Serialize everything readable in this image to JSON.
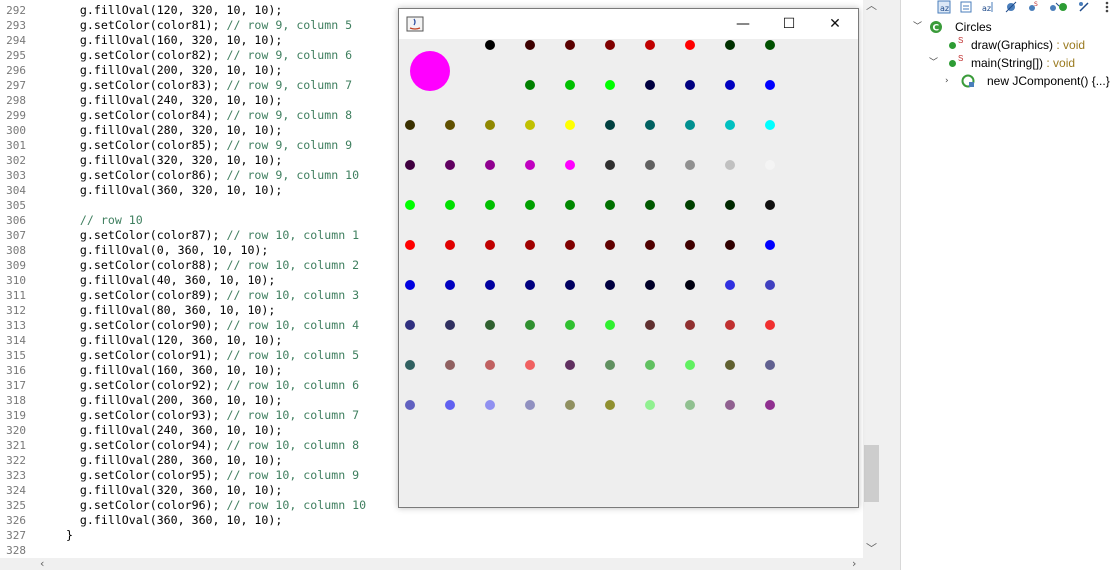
{
  "editor": {
    "lines": [
      {
        "num": "292",
        "code": "    g.fillOval(120, 320, 10, 10);",
        "comment": ""
      },
      {
        "num": "293",
        "code": "    g.setColor(color81); ",
        "comment": "// row 9, column 5"
      },
      {
        "num": "294",
        "code": "    g.fillOval(160, 320, 10, 10);",
        "comment": ""
      },
      {
        "num": "295",
        "code": "    g.setColor(color82); ",
        "comment": "// row 9, column 6"
      },
      {
        "num": "296",
        "code": "    g.fillOval(200, 320, 10, 10);",
        "comment": ""
      },
      {
        "num": "297",
        "code": "    g.setColor(color83); ",
        "comment": "// row 9, column 7"
      },
      {
        "num": "298",
        "code": "    g.fillOval(240, 320, 10, 10);",
        "comment": ""
      },
      {
        "num": "299",
        "code": "    g.setColor(color84); ",
        "comment": "// row 9, column 8"
      },
      {
        "num": "300",
        "code": "    g.fillOval(280, 320, 10, 10);",
        "comment": ""
      },
      {
        "num": "301",
        "code": "    g.setColor(color85); ",
        "comment": "// row 9, column 9"
      },
      {
        "num": "302",
        "code": "    g.fillOval(320, 320, 10, 10);",
        "comment": ""
      },
      {
        "num": "303",
        "code": "    g.setColor(color86); ",
        "comment": "// row 9, column 10"
      },
      {
        "num": "304",
        "code": "    g.fillOval(360, 320, 10, 10);",
        "comment": ""
      },
      {
        "num": "305",
        "code": "",
        "comment": ""
      },
      {
        "num": "306",
        "code": "    ",
        "comment": "// row 10"
      },
      {
        "num": "307",
        "code": "    g.setColor(color87); ",
        "comment": "// row 10, column 1"
      },
      {
        "num": "308",
        "code": "    g.fillOval(0, 360, 10, 10);",
        "comment": ""
      },
      {
        "num": "309",
        "code": "    g.setColor(color88); ",
        "comment": "// row 10, column 2"
      },
      {
        "num": "310",
        "code": "    g.fillOval(40, 360, 10, 10);",
        "comment": ""
      },
      {
        "num": "311",
        "code": "    g.setColor(color89); ",
        "comment": "// row 10, column 3"
      },
      {
        "num": "312",
        "code": "    g.fillOval(80, 360, 10, 10);",
        "comment": ""
      },
      {
        "num": "313",
        "code": "    g.setColor(color90); ",
        "comment": "// row 10, column 4"
      },
      {
        "num": "314",
        "code": "    g.fillOval(120, 360, 10, 10);",
        "comment": ""
      },
      {
        "num": "315",
        "code": "    g.setColor(color91); ",
        "comment": "// row 10, column 5"
      },
      {
        "num": "316",
        "code": "    g.fillOval(160, 360, 10, 10);",
        "comment": ""
      },
      {
        "num": "317",
        "code": "    g.setColor(color92); ",
        "comment": "// row 10, column 6"
      },
      {
        "num": "318",
        "code": "    g.fillOval(200, 360, 10, 10);",
        "comment": ""
      },
      {
        "num": "319",
        "code": "    g.setColor(color93); ",
        "comment": "// row 10, column 7"
      },
      {
        "num": "320",
        "code": "    g.fillOval(240, 360, 10, 10);",
        "comment": ""
      },
      {
        "num": "321",
        "code": "    g.setColor(color94); ",
        "comment": "// row 10, column 8"
      },
      {
        "num": "322",
        "code": "    g.fillOval(280, 360, 10, 10);",
        "comment": ""
      },
      {
        "num": "323",
        "code": "    g.setColor(color95); ",
        "comment": "// row 10, column 9"
      },
      {
        "num": "324",
        "code": "    g.fillOval(320, 360, 10, 10);",
        "comment": ""
      },
      {
        "num": "325",
        "code": "    g.setColor(color96); ",
        "comment": "// row 10, column 10"
      },
      {
        "num": "326",
        "code": "    g.fillOval(360, 360, 10, 10);",
        "comment": ""
      },
      {
        "num": "327",
        "code": "  }",
        "comment": ""
      },
      {
        "num": "328",
        "code": "",
        "comment": ""
      }
    ]
  },
  "outline": {
    "class_name": "Circles",
    "method_draw": "draw(Graphics)",
    "method_draw_ret": " : void",
    "method_main": "main(String[])",
    "method_main_ret": " : void",
    "anon_class": "new JComponent() {...}",
    "static_marker": "S"
  },
  "java_window": {
    "controls": {
      "minimize": "—",
      "maximize": "☐",
      "close": "✕"
    },
    "big_circle_color": "#ff00ff",
    "rows": [
      [
        "",
        "#000000",
        "#3d0000",
        "#5a0000",
        "#800000",
        "#c00000",
        "#ff0000",
        "#003000",
        "#005000"
      ],
      [
        "",
        "#008000",
        "#00c000",
        "#00ff00",
        "#000040",
        "#000080",
        "#0000c0",
        "#0000ff"
      ],
      [
        "#3a3000",
        "#605000",
        "#908800",
        "#c0c000",
        "#ffff00",
        "#004040",
        "#006060",
        "#009090",
        "#00c0c0",
        "#00ffff"
      ],
      [
        "#400040",
        "#600060",
        "#900090",
        "#c000c0",
        "#ff00ff",
        "#303030",
        "#606060",
        "#909090",
        "#c0c0c0",
        "#f4f4f4"
      ],
      [
        "#00ff00",
        "#00e000",
        "#00c000",
        "#00a000",
        "#008800",
        "#007000",
        "#005800",
        "#004000",
        "#002800",
        "#101010"
      ],
      [
        "#ff0000",
        "#e00000",
        "#c00000",
        "#a00000",
        "#800000",
        "#600000",
        "#500000",
        "#400000",
        "#300000",
        "#0000ff"
      ],
      [
        "#0000e0",
        "#0000c0",
        "#0000a0",
        "#000080",
        "#000060",
        "#000040",
        "#000028",
        "#000010",
        "#3030e0",
        "#4040c0"
      ],
      [
        "#303080",
        "#303060",
        "#306030",
        "#309030",
        "#30c030",
        "#30f030",
        "#603030",
        "#903030",
        "#c03030",
        "#f03030"
      ],
      [
        "#306060",
        "#906060",
        "#c06060",
        "#f06060",
        "#603060",
        "#609060",
        "#60c060",
        "#60f060",
        "#606030",
        "#606090"
      ],
      [
        "#6060c0",
        "#6060f0",
        "#9090f0",
        "#9090c0",
        "#909060",
        "#909030",
        "#90f090",
        "#90c090",
        "#906090",
        "#903090"
      ]
    ]
  }
}
